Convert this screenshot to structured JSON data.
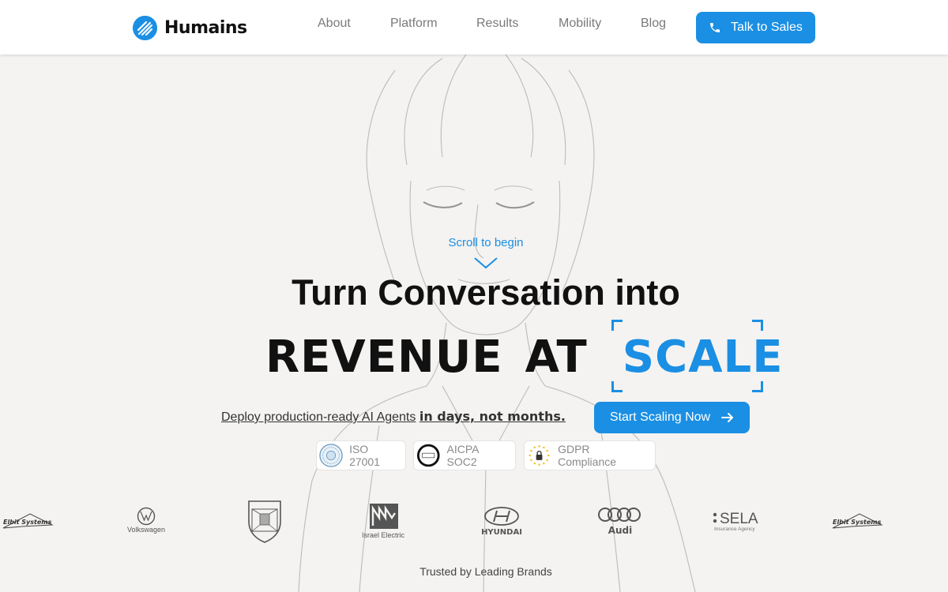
{
  "header": {
    "logo_text": "Humains",
    "nav": [
      "About",
      "Platform",
      "Results",
      "Mobility",
      "Blog"
    ],
    "cta_label": "Talk to Sales"
  },
  "hero": {
    "scroll_hint": "Scroll to begin",
    "headline_line1": "Turn Conversation into",
    "headline_line2_a": "REVENUE",
    "headline_line2_b": "AT",
    "headline_line2_highlight": "SCALE",
    "subline_plain": "Deploy production-ready AI Agents",
    "subline_bold": "in days, not months.",
    "cta_label": "Start Scaling Now"
  },
  "badges": [
    {
      "label": "ISO 27001",
      "icon": "iso-seal-icon"
    },
    {
      "label": "AICPA SOC2",
      "icon": "aicpa-soc2-icon"
    },
    {
      "label": "GDPR Compliance",
      "icon": "gdpr-lock-icon"
    }
  ],
  "brands": [
    {
      "name": "Elbit Systems"
    },
    {
      "name": "Volkswagen"
    },
    {
      "name": "Porsche",
      "icon": "porsche-crest-icon"
    },
    {
      "name": "Israel Electric"
    },
    {
      "name": "HYUNDAI"
    },
    {
      "name": "Audi"
    },
    {
      "name": "SELA",
      "sub": "Insurance Agency"
    },
    {
      "name": "Elbit Systems"
    }
  ],
  "footer": {
    "trusted_label": "Trusted by Leading Brands"
  },
  "colors": {
    "accent": "#1a8fe3",
    "background": "#f4f3f1",
    "text": "#111111",
    "nav_text": "#7a7a7a"
  }
}
